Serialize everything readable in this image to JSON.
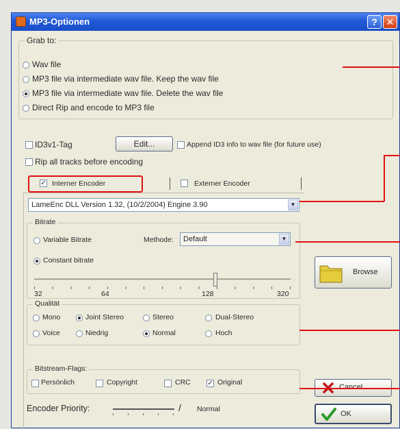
{
  "window": {
    "title": "MP3-Optionen",
    "help_label": "?",
    "close_label": "✕"
  },
  "grab": {
    "legend": "Grab to:",
    "options": [
      {
        "label": "Wav file",
        "selected": false
      },
      {
        "label": "MP3 file via intermediate wav file. Keep the wav file",
        "selected": false
      },
      {
        "label": "MP3 file via intermediate wav file. Delete the wav file",
        "selected": true
      },
      {
        "label": "Direct Rip and encode to MP3 file",
        "selected": false
      }
    ]
  },
  "id3": {
    "label": "ID3v1-Tag",
    "checked": false,
    "edit_label": "Edit...",
    "append_label": "Append ID3 info to wav file (for future use)"
  },
  "rip_all": {
    "label": "Rip all tracks before encoding",
    "checked": false
  },
  "tabs": [
    {
      "label": "Interner Encoder",
      "checked": true
    },
    {
      "label": "Externer Encoder",
      "checked": false
    }
  ],
  "encoder": {
    "value": "LameEnc DLL Version 1.32, (10/2/2004) Engine 3.90"
  },
  "bitrate": {
    "legend": "Bitrate",
    "variable_label": "Variable Bitrate",
    "method_label": "Methode:",
    "method_value": "Default",
    "constant_label": "Constant bitrate",
    "slider_value": 128,
    "slider_ticks": [
      "32",
      "64",
      "128",
      "320"
    ]
  },
  "quality": {
    "legend": "Qualität",
    "row1": [
      {
        "label": "Mono",
        "selected": false
      },
      {
        "label": "Joint Stereo",
        "selected": true
      },
      {
        "label": "Stereo",
        "selected": false
      },
      {
        "label": "Dual-Stereo",
        "selected": false
      }
    ],
    "row2": [
      {
        "label": "Voice",
        "selected": false
      },
      {
        "label": "Niedrig",
        "selected": false
      },
      {
        "label": "Normal",
        "selected": true
      },
      {
        "label": "Hoch",
        "selected": false
      }
    ]
  },
  "flags": {
    "legend": "Bitstream-Flags:",
    "items": [
      {
        "label": "Persönlich",
        "checked": false
      },
      {
        "label": "Copyright",
        "checked": false
      },
      {
        "label": "CRC",
        "checked": false
      },
      {
        "label": "Original",
        "checked": true
      }
    ]
  },
  "priority": {
    "label": "Encoder Priority:",
    "value": "Normal"
  },
  "buttons": {
    "browse": "Browse",
    "cancel": "Cancel",
    "ok": "OK"
  },
  "colors": {
    "titlebar": "#2058d6",
    "callout": "#e01010",
    "window_bg": "#ecebdc"
  }
}
